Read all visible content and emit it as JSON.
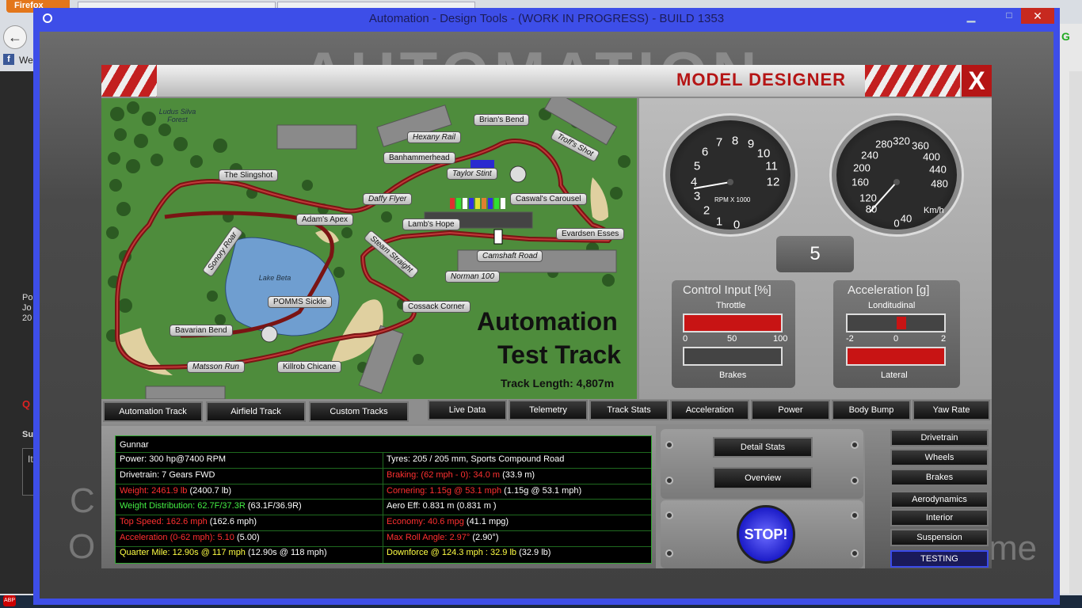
{
  "browser": {
    "firefox_label": "Firefox",
    "bookmark_label": "We",
    "left_panel_text": "Po Jo 20",
    "left_red": "Q",
    "left_su": "Su",
    "left_box": "It"
  },
  "window": {
    "title": "Automation - Design Tools - (WORK IN PROGRESS) - BUILD 1353",
    "close_glyph": "✕",
    "min_glyph": "▁",
    "max_glyph": "□"
  },
  "background": {
    "logo": "AUTOMATION",
    "text_1": "C",
    "text_2": "O",
    "text_3": "me"
  },
  "designer": {
    "title": "MODEL DESIGNER",
    "close_label": "X"
  },
  "track": {
    "title_line1": "Automation",
    "title_line2": "Test Track",
    "length": "Track Length: 4,807m",
    "forest_label": "Ludus Silva Forest",
    "lake_label": "Lake Beta",
    "corners": [
      "Brian's Bend",
      "Hexany Rail",
      "Troff's Shot",
      "Banhammerhead",
      "Taylor Stint",
      "The Slingshot",
      "Daffy Flyer",
      "Caswal's Carousel",
      "Adam's Apex",
      "Lamb's Hope",
      "Evardsen Esses",
      "Sonory Roar",
      "Steam Straight",
      "Camshaft Road",
      "Norman 100",
      "POMMS Sickle",
      "Cossack Corner",
      "Bavarian Bend",
      "Matsson Run",
      "Killrob Chicane"
    ]
  },
  "gauges": {
    "rpm_numbers": [
      "0",
      "1",
      "2",
      "3",
      "4",
      "5",
      "6",
      "7",
      "8",
      "9",
      "10",
      "11",
      "12"
    ],
    "rpm_label": "RPM X 1000",
    "speed_numbers": [
      "0",
      "40",
      "80",
      "120",
      "160",
      "200",
      "240",
      "280",
      "320",
      "360",
      "400",
      "440",
      "480"
    ],
    "speed_label": "Km/h",
    "gear": "5"
  },
  "control_input": {
    "title": "Control Input [%]",
    "throttle_label": "Throttle",
    "throttle_value": 1.0,
    "scale": [
      "0",
      "50",
      "100"
    ],
    "brakes_label": "Brakes",
    "brakes_value": 0.0
  },
  "acceleration": {
    "title": "Acceleration [g]",
    "longitudinal_label": "Londitudinal",
    "scale": [
      "-2",
      "0",
      "2"
    ],
    "lateral_label": "Lateral"
  },
  "track_tabs": [
    "Automation Track",
    "Airfield Track",
    "Custom Tracks"
  ],
  "data_tabs": [
    "Live Data",
    "Telemetry",
    "Track Stats",
    "Acceleration",
    "Power",
    "Body Bump",
    "Yaw Rate"
  ],
  "stats": {
    "name": "Gunnar",
    "left": [
      {
        "text": "Power: 300 hp@7400 RPM",
        "color": "#ffffff"
      },
      {
        "text": "Drivetrain: 7 Gears FWD",
        "color": "#ffffff"
      },
      {
        "text": "Weight: 2461.9 lb",
        "extra": " (2400.7 lb)",
        "color": "#ff3030"
      },
      {
        "text": "Weight Distribution: 62.7F/37.3R",
        "extra": " (63.1F/36.9R)",
        "color": "#44ee44"
      },
      {
        "text": "Top Speed: 162.6 mph",
        "extra": " (162.6 mph)",
        "color": "#ff3030"
      },
      {
        "text": "Acceleration (0-62 mph): 5.10",
        "extra": " (5.00)",
        "color": "#ff3030"
      },
      {
        "text": "Quarter Mile: 12.90s @ 117 mph",
        "extra": " (12.90s @ 118 mph)",
        "color": "#ffff44"
      }
    ],
    "right": [
      {
        "text": "Tyres: 205 / 205 mm, Sports Compound Road",
        "color": "#ffffff"
      },
      {
        "text": "Braking: (62 mph - 0): 34.0 m",
        "extra": " (33.9 m)",
        "color": "#ff3030"
      },
      {
        "text": "Cornering: 1.15g @ 53.1 mph",
        "extra": " (1.15g @ 53.1 mph)",
        "color": "#ff3030"
      },
      {
        "text": "Aero Eff: 0.831 m",
        "extra": "  (0.831 m )",
        "color": "#ffffff"
      },
      {
        "text": "Economy: 40.6 mpg",
        "extra": " (41.1 mpg)",
        "color": "#ff3030"
      },
      {
        "text": "Max Roll Angle: 2.97°",
        "extra": " (2.90°)",
        "color": "#ff3030"
      },
      {
        "text": "Downforce @ 124.3 mph : 32.9 lb",
        "extra": " (32.9 lb)",
        "color": "#ffff44"
      }
    ]
  },
  "controls": {
    "detail_stats": "Detail Stats",
    "overview": "Overview",
    "stop": "STOP!"
  },
  "nav": [
    "Drivetrain",
    "Wheels",
    "Brakes",
    "Aerodynamics",
    "Interior",
    "Suspension",
    "TESTING"
  ]
}
